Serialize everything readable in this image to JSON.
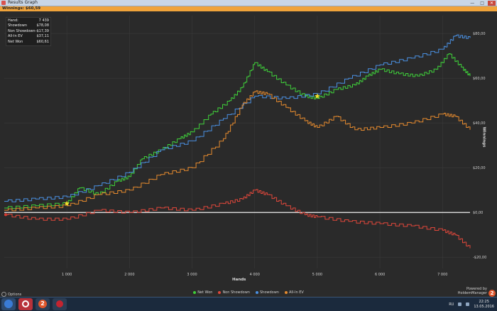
{
  "window": {
    "title": "Results Graph",
    "minimize": "—",
    "maximize": "□",
    "close": "✕"
  },
  "infobar": {
    "label": "Winnings: $60,59"
  },
  "stats": [
    {
      "label": "Hand:",
      "value": "7 439"
    },
    {
      "label": "Showdown",
      "value": "$78,08"
    },
    {
      "label": "Non Showdown",
      "value": "-$17,39"
    },
    {
      "label": "All-In EV",
      "value": "$37,11"
    },
    {
      "label": "Net Won",
      "value": "$60,61"
    }
  ],
  "axes": {
    "xlabel": "Hands",
    "ylabel": "Winnings"
  },
  "legend": [
    {
      "label": "Net Won",
      "color": "#3fcf3a"
    },
    {
      "label": "Non Showdown",
      "color": "#e0473b"
    },
    {
      "label": "Showdown",
      "color": "#4a90e2"
    },
    {
      "label": "All-In EV",
      "color": "#e58a2e"
    }
  ],
  "footer": {
    "options_label": "Options",
    "brand_line1": "Powered by",
    "brand_line2": "HoldemManager",
    "brand_badge": "2"
  },
  "taskbar": {
    "lang": "RU",
    "time": "22:25",
    "date": "13.05.2016",
    "hm_badge": "2"
  },
  "chart_data": {
    "type": "line",
    "xlabel": "Hands",
    "ylabel": "Winnings",
    "x_ticks": [
      "1 000",
      "2 000",
      "3 000",
      "4 000",
      "5 000",
      "6 000",
      "7 000"
    ],
    "y_ticks": [
      "-$20,00",
      "$0,00",
      "$20,00",
      "$40,00",
      "$60,00",
      "$80,00"
    ],
    "xlim": [
      0,
      7439
    ],
    "ylim": [
      -25,
      88
    ],
    "grid": true,
    "legend_position": "bottom",
    "series": [
      {
        "name": "Net Won",
        "color": "#3fcf3a",
        "x": [
          0,
          500,
          1000,
          1200,
          1500,
          1800,
          2000,
          2200,
          2500,
          2800,
          3000,
          3300,
          3600,
          3800,
          4000,
          4200,
          4500,
          4800,
          5000,
          5300,
          5600,
          5800,
          6000,
          6300,
          6600,
          6900,
          7100,
          7300,
          7439
        ],
        "y": [
          2,
          3,
          4,
          11,
          8,
          14,
          16,
          24,
          28,
          33,
          36,
          44,
          50,
          56,
          67,
          63,
          57,
          52,
          51,
          55,
          57,
          61,
          64,
          62,
          61,
          64,
          71,
          65,
          61
        ]
      },
      {
        "name": "Non Showdown",
        "color": "#e0473b",
        "x": [
          0,
          500,
          1000,
          1500,
          2000,
          2500,
          3000,
          3500,
          3800,
          4000,
          4200,
          4500,
          4800,
          5000,
          5500,
          6000,
          6500,
          7000,
          7200,
          7439
        ],
        "y": [
          -1,
          -3,
          -3,
          1,
          0,
          2,
          1,
          4,
          6,
          10,
          8,
          3,
          -1,
          -2,
          -4,
          -5,
          -6,
          -8,
          -10,
          -16
        ]
      },
      {
        "name": "Showdown",
        "color": "#4a90e2",
        "x": [
          0,
          500,
          1000,
          1500,
          2000,
          2500,
          3000,
          3500,
          4000,
          4500,
          5000,
          5500,
          6000,
          6500,
          7000,
          7200,
          7439
        ],
        "y": [
          5,
          6,
          7,
          12,
          18,
          28,
          32,
          42,
          52,
          51,
          53,
          60,
          66,
          69,
          73,
          79,
          78
        ]
      },
      {
        "name": "All-In EV",
        "color": "#e58a2e",
        "x": [
          0,
          500,
          1000,
          1500,
          2000,
          2500,
          3000,
          3500,
          3800,
          4000,
          4200,
          4500,
          4800,
          5000,
          5300,
          5600,
          6000,
          6500,
          7000,
          7200,
          7439
        ],
        "y": [
          1,
          2,
          3,
          8,
          10,
          17,
          20,
          33,
          48,
          54,
          53,
          47,
          41,
          38,
          43,
          37,
          38,
          40,
          44,
          43,
          37
        ]
      }
    ],
    "markers": [
      {
        "x": 1000,
        "y": 4,
        "color": "#f2e12c"
      },
      {
        "x": 5000,
        "y": 52,
        "color": "#f2e12c"
      }
    ]
  }
}
